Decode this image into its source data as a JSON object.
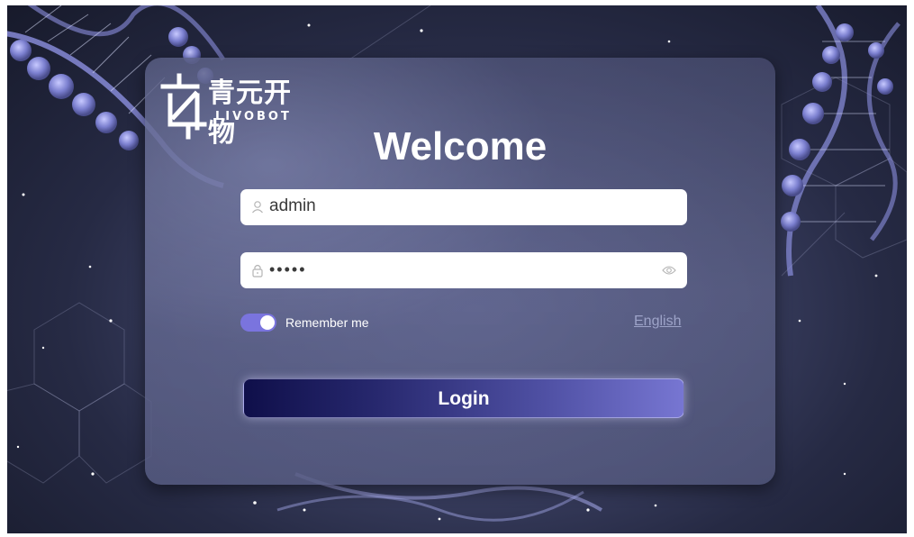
{
  "brand": {
    "name_cn": "青元开物",
    "name_en": "LIVOBOT"
  },
  "login": {
    "title": "Welcome",
    "username_value": "admin",
    "password_value": "•••••",
    "remember_label": "Remember me",
    "remember_checked": true,
    "language_link": "English",
    "login_button": "Login"
  },
  "icons": {
    "username": "user-icon",
    "password": "lock-icon",
    "reveal": "eye-icon"
  },
  "colors": {
    "accent": "#7a74de",
    "button_start": "#0f0f4a",
    "button_end": "#7776d2",
    "link": "#9da3c8"
  }
}
